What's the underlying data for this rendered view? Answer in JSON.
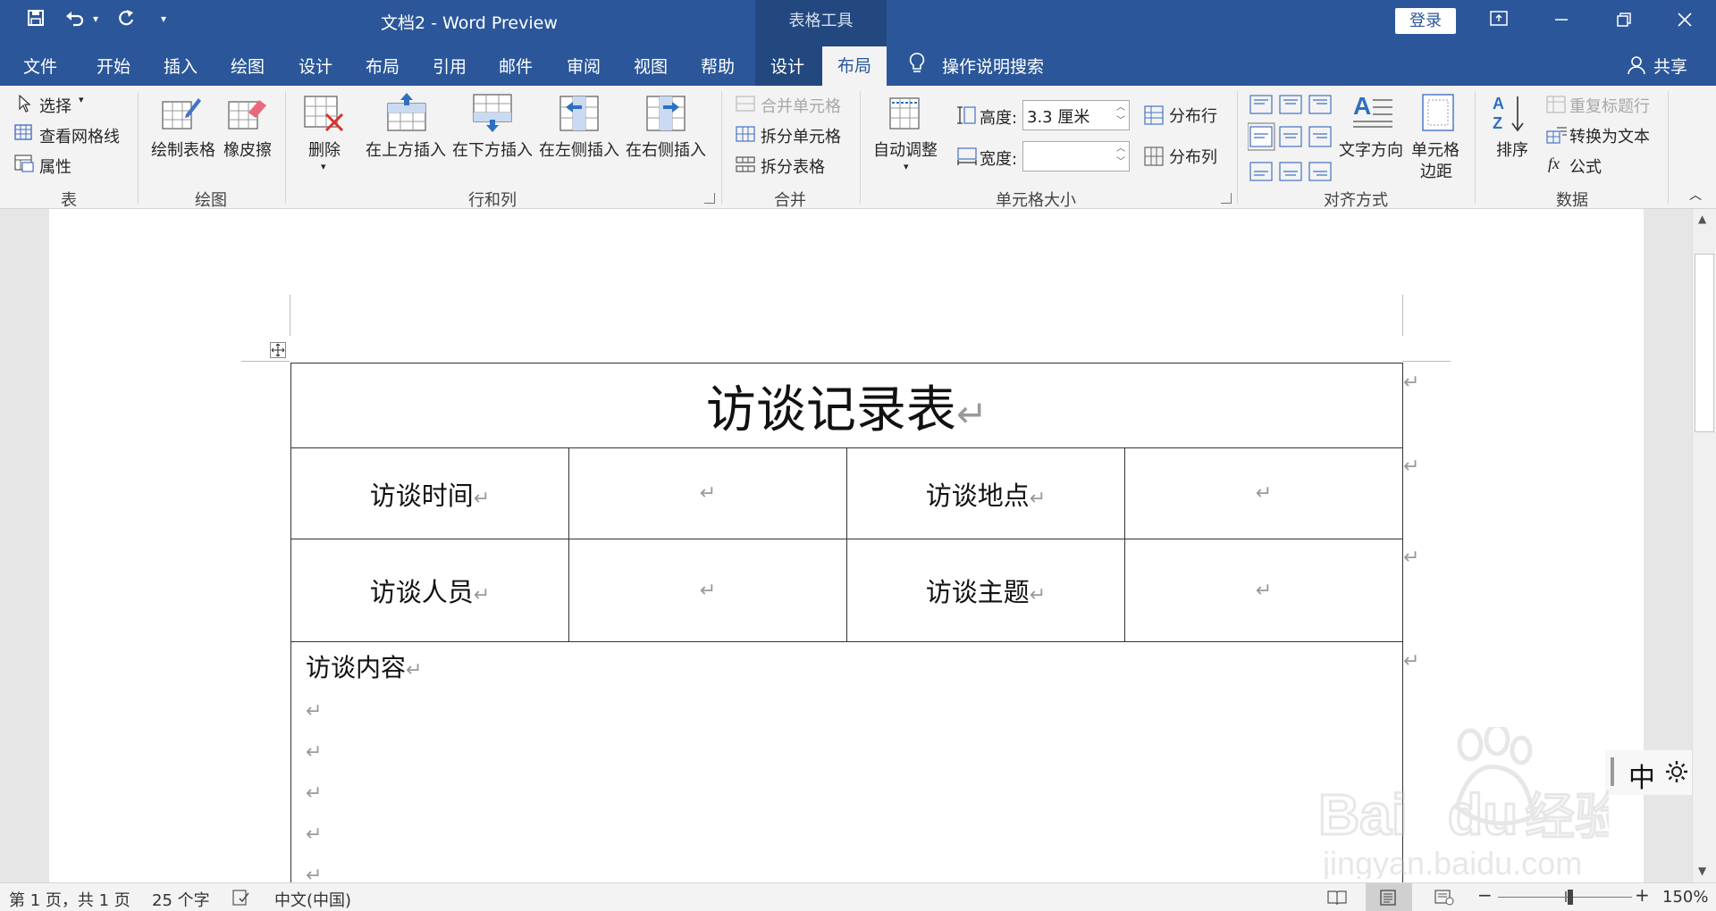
{
  "app": {
    "doc_title": "文档2  -  Word Preview",
    "table_tools": "表格工具",
    "login": "登录",
    "share": "共享",
    "search": "操作说明搜索"
  },
  "tabs": [
    "文件",
    "开始",
    "插入",
    "绘图",
    "设计",
    "布局",
    "引用",
    "邮件",
    "审阅",
    "视图",
    "帮助",
    "设计",
    "布局"
  ],
  "active_tab": "布局",
  "ribbon": {
    "table": {
      "select": "选择",
      "gridlines": "查看网格线",
      "properties": "属性",
      "label": "表"
    },
    "draw": {
      "draw_table": "绘制表格",
      "eraser": "橡皮擦",
      "label": "绘图"
    },
    "rows_cols": {
      "delete": "删除",
      "insert_above": "在上方插入",
      "insert_below": "在下方插入",
      "insert_left": "在左侧插入",
      "insert_right": "在右侧插入",
      "label": "行和列"
    },
    "merge": {
      "merge_cells": "合并单元格",
      "split_cells": "拆分单元格",
      "split_table": "拆分表格",
      "label": "合并"
    },
    "cell_size": {
      "autofit": "自动调整",
      "height_label": "高度:",
      "height_value": "3.3 厘米",
      "width_label": "宽度:",
      "width_value": "",
      "dist_rows": "分布行",
      "dist_cols": "分布列",
      "label": "单元格大小"
    },
    "align": {
      "text_direction": "文字方向",
      "cell_margins_1": "单元格",
      "cell_margins_2": "边距",
      "label": "对齐方式"
    },
    "data": {
      "sort": "排序",
      "repeat_header": "重复标题行",
      "convert_text": "转换为文本",
      "formula": "公式",
      "label": "数据"
    }
  },
  "document": {
    "title": "访谈记录表",
    "row1": {
      "k1": "访谈时间",
      "k2": "访谈地点"
    },
    "row2": {
      "k1": "访谈人员",
      "k2": "访谈主题"
    },
    "content_label": "访谈内容",
    "return_mark": "↵"
  },
  "status": {
    "page": "第 1 页，共 1 页",
    "words": "25 个字",
    "language": "中文(中国)",
    "zoom": "150%"
  },
  "ime": {
    "mode": "中"
  },
  "watermark": "Baidu经验 jingyan.baidu.com",
  "colors": {
    "title_bar": "#2b579a",
    "ribbon": "#f3f3f3"
  }
}
